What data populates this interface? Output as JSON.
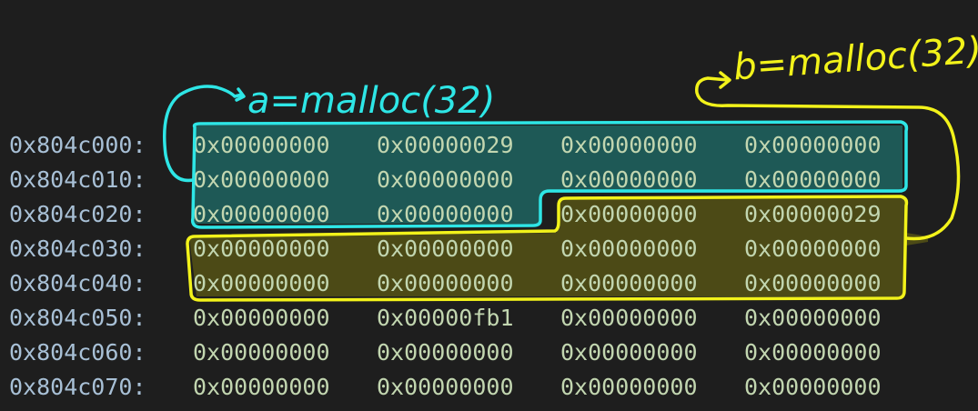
{
  "dump": {
    "rows": [
      {
        "address": "0x804c000:",
        "words": [
          "0x00000000",
          "0x00000029",
          "0x00000000",
          "0x00000000"
        ]
      },
      {
        "address": "0x804c010:",
        "words": [
          "0x00000000",
          "0x00000000",
          "0x00000000",
          "0x00000000"
        ]
      },
      {
        "address": "0x804c020:",
        "words": [
          "0x00000000",
          "0x00000000",
          "0x00000000",
          "0x00000029"
        ]
      },
      {
        "address": "0x804c030:",
        "words": [
          "0x00000000",
          "0x00000000",
          "0x00000000",
          "0x00000000"
        ]
      },
      {
        "address": "0x804c040:",
        "words": [
          "0x00000000",
          "0x00000000",
          "0x00000000",
          "0x00000000"
        ]
      },
      {
        "address": "0x804c050:",
        "words": [
          "0x00000000",
          "0x00000fb1",
          "0x00000000",
          "0x00000000"
        ]
      },
      {
        "address": "0x804c060:",
        "words": [
          "0x00000000",
          "0x00000000",
          "0x00000000",
          "0x00000000"
        ]
      },
      {
        "address": "0x804c070:",
        "words": [
          "0x00000000",
          "0x00000000",
          "0x00000000",
          "0x00000000"
        ]
      }
    ]
  },
  "annotations": {
    "chunk_a": {
      "label": "a=malloc(32)",
      "color": "#2ee6e6",
      "fill": "#1f6e6a"
    },
    "chunk_b": {
      "label": "b=malloc(32)",
      "color": "#f2f21a",
      "fill": "#5c5a14"
    }
  }
}
